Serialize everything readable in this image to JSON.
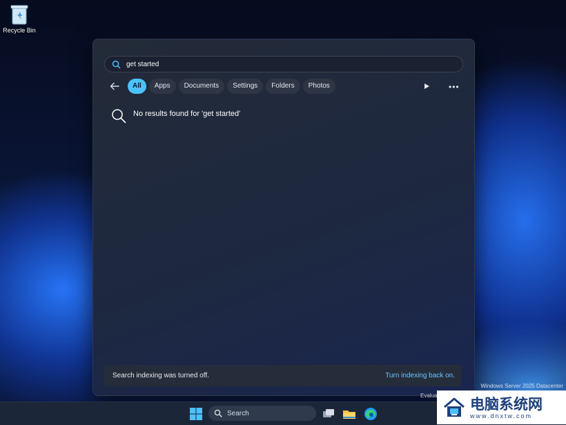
{
  "desktop": {
    "recycle_bin_label": "Recycle Bin"
  },
  "search_panel": {
    "query": "get started",
    "filters": [
      {
        "label": "All",
        "active": true
      },
      {
        "label": "Apps",
        "active": false
      },
      {
        "label": "Documents",
        "active": false
      },
      {
        "label": "Settings",
        "active": false
      },
      {
        "label": "Folders",
        "active": false
      },
      {
        "label": "Photos",
        "active": false
      }
    ],
    "more_label": "•••",
    "no_results": "No results found for 'get started'",
    "footer_text": "Search indexing was turned off.",
    "footer_link": "Turn indexing back on."
  },
  "watermark": {
    "line1": "Windows Server 2025 Datacenter",
    "line2": "Evalua"
  },
  "taskbar": {
    "search_placeholder": "Search",
    "apps": [
      "task-view",
      "file-explorer",
      "edge"
    ]
  },
  "brand": {
    "chinese": "电脑系统网",
    "url": "www.dnxtw.com"
  },
  "colors": {
    "accent": "#4cc2ff",
    "panel": "#1f2838",
    "link": "#6cc6ff"
  }
}
